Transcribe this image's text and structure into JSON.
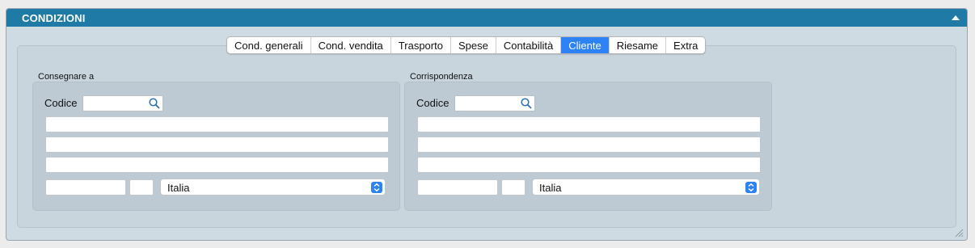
{
  "panel": {
    "title": "CONDIZIONI"
  },
  "tabs": [
    {
      "label": "Cond. generali",
      "active": false
    },
    {
      "label": "Cond. vendita",
      "active": false
    },
    {
      "label": "Trasporto",
      "active": false
    },
    {
      "label": "Spese",
      "active": false
    },
    {
      "label": "Contabilità",
      "active": false
    },
    {
      "label": "Cliente",
      "active": true
    },
    {
      "label": "Riesame",
      "active": false
    },
    {
      "label": "Extra",
      "active": false
    }
  ],
  "consegnare": {
    "label": "Consegnare a",
    "codice_label": "Codice",
    "codice_value": "",
    "address_lines": [
      "",
      "",
      ""
    ],
    "cap": "",
    "provincia": "",
    "country": "Italia"
  },
  "corrispondenza": {
    "label": "Corrispondenza",
    "codice_label": "Codice",
    "codice_value": "",
    "address_lines": [
      "",
      "",
      ""
    ],
    "cap": "",
    "provincia": "",
    "country": "Italia"
  },
  "colors": {
    "header": "#1f7aa5",
    "accent": "#2d83f5",
    "panel_bg": "#cfdbe2"
  }
}
